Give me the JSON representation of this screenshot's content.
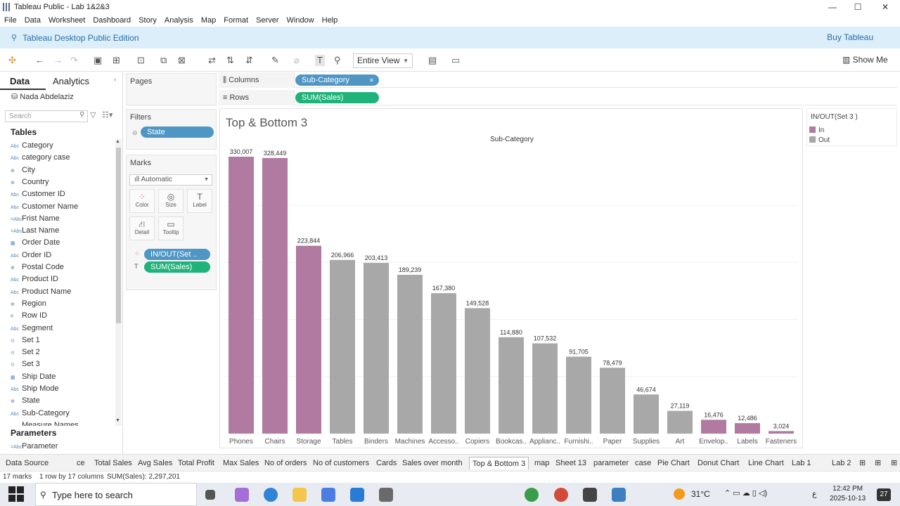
{
  "window": {
    "title": "Tableau Public - Lab 1&2&3",
    "min": "—",
    "max": "☐",
    "close": "✕"
  },
  "menu": [
    "File",
    "Data",
    "Worksheet",
    "Dashboard",
    "Story",
    "Analysis",
    "Map",
    "Format",
    "Server",
    "Window",
    "Help"
  ],
  "banner": {
    "edition": "Tableau Desktop Public Edition",
    "buy": "Buy Tableau"
  },
  "toolbar": {
    "view": "Entire View",
    "show_me": "Show Me"
  },
  "left": {
    "tab_data": "Data",
    "tab_analytics": "Analytics",
    "user": "Nada Abdelaziz",
    "search_placeholder": "Search",
    "tables_header": "Tables",
    "parameters_header": "Parameters",
    "fields": [
      {
        "icon": "Abc",
        "name": "Category"
      },
      {
        "icon": "Abc",
        "name": "category case"
      },
      {
        "icon": "⊕",
        "name": "City"
      },
      {
        "icon": "⊕",
        "name": "Country"
      },
      {
        "icon": "Abc",
        "name": "Customer ID"
      },
      {
        "icon": "Abc",
        "name": "Customer Name"
      },
      {
        "icon": "=Abc",
        "name": "Frist Name"
      },
      {
        "icon": "=Abc",
        "name": "Last Name"
      },
      {
        "icon": "▦",
        "name": "Order Date"
      },
      {
        "icon": "Abc",
        "name": "Order ID"
      },
      {
        "icon": "⊕",
        "name": "Postal Code"
      },
      {
        "icon": "Abc",
        "name": "Product ID"
      },
      {
        "icon": "Abc",
        "name": "Product Name"
      },
      {
        "icon": "⊕",
        "name": "Region"
      },
      {
        "icon": "#",
        "name": "Row ID"
      },
      {
        "icon": "Abc",
        "name": "Segment"
      },
      {
        "icon": "⊙",
        "name": "Set 1"
      },
      {
        "icon": "⊙",
        "name": "Set 2"
      },
      {
        "icon": "⊙",
        "name": "Set 3"
      },
      {
        "icon": "▦",
        "name": "Ship Date"
      },
      {
        "icon": "Abc",
        "name": "Ship Mode"
      },
      {
        "icon": "⊕",
        "name": "State"
      },
      {
        "icon": "Abc",
        "name": "Sub-Category"
      },
      {
        "icon": "",
        "name": "Measure Names"
      }
    ],
    "parameters": [
      {
        "icon": "=Abc",
        "name": "Parameter"
      }
    ]
  },
  "cards": {
    "pages": "Pages",
    "filters": "Filters",
    "filter_pill": "State",
    "marks": "Marks",
    "mark_type": "Automatic",
    "mark_buttons": [
      "Color",
      "Size",
      "Label",
      "Detail",
      "Tooltip"
    ],
    "marks_pills": [
      "IN/OUT(Set ..",
      "SUM(Sales)"
    ]
  },
  "shelves": {
    "columns_label": "Columns",
    "rows_label": "Rows",
    "columns_pill": "Sub-Category",
    "rows_pill": "SUM(Sales)"
  },
  "legend": {
    "title": "IN/OUT(Set 3 )",
    "items": [
      {
        "label": "In",
        "color": "#b07aa1"
      },
      {
        "label": "Out",
        "color": "#a8a8a8"
      }
    ]
  },
  "chart_data": {
    "type": "bar",
    "title": "Top & Bottom 3",
    "xlabel": "Sub-Category",
    "categories": [
      "Phones",
      "Chairs",
      "Storage",
      "Tables",
      "Binders",
      "Machines",
      "Accesso..",
      "Copiers",
      "Bookcas..",
      "Applianc..",
      "Furnishi..",
      "Paper",
      "Supplies",
      "Art",
      "Envelop..",
      "Labels",
      "Fasteners"
    ],
    "values": [
      330007,
      328449,
      223844,
      206966,
      203413,
      189239,
      167380,
      149528,
      114880,
      107532,
      91705,
      78479,
      46674,
      27119,
      16476,
      12486,
      3024
    ],
    "value_labels": [
      "330,007",
      "328,449",
      "223,844",
      "206,966",
      "203,413",
      "189,239",
      "167,380",
      "149,528",
      "114,880",
      "107,532",
      "91,705",
      "78,479",
      "46,674",
      "27,119",
      "16,476",
      "12,486",
      "3,024"
    ],
    "set_membership": [
      "In",
      "In",
      "In",
      "Out",
      "Out",
      "Out",
      "Out",
      "Out",
      "Out",
      "Out",
      "Out",
      "Out",
      "Out",
      "Out",
      "In",
      "In",
      "In"
    ],
    "colors": {
      "In": "#b07aa1",
      "Out": "#a8a8a8"
    },
    "ylim": [
      0,
      340000
    ],
    "grid": true
  },
  "sheet_tabs": [
    "Data Source",
    "ce",
    "Total Sales",
    "Avg Sales",
    "Total Profit",
    "Max Sales",
    "No of orders",
    "No of customers",
    "Cards",
    "Sales over month",
    "Top & Bottom 3",
    "map",
    "Sheet 13",
    "parameter",
    "case",
    "Pie Chart",
    "Donut Chart",
    "Line Chart",
    "Lab 1",
    "Lab 2"
  ],
  "active_tab": "Top & Bottom 3",
  "status": {
    "marks": "17 marks",
    "dims": "1 row by 17 columns",
    "sum": "SUM(Sales): 2,297,201"
  },
  "taskbar": {
    "search": "Type here to search",
    "weather": "31°C",
    "time": "12:42 PM",
    "date": "2025-10-13",
    "lang": "ع",
    "notif": "27"
  }
}
